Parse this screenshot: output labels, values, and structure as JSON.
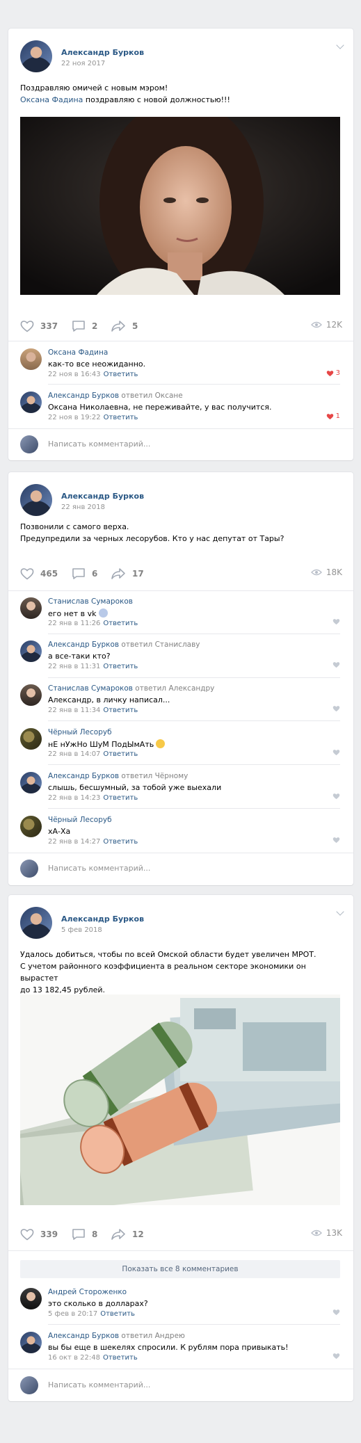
{
  "colors": {
    "link": "#2a5885",
    "muted": "#939393",
    "like": "#e64646",
    "bg": "#edeef0"
  },
  "posts": [
    {
      "author": "Александр Бурков",
      "date": "22 ноя 2017",
      "text_line1": "Поздравляю омичей с новым мэром!",
      "text_link": "Оксана Фадина",
      "text_after_link": " поздравляю с новой должностью!!!",
      "likes": "337",
      "comments": "2",
      "shares": "5",
      "views": "12K",
      "comment_list": [
        {
          "author": "Оксана Фадина",
          "replied": "",
          "text": "как-то все неожиданно.",
          "time": "22 ноя в 16:43",
          "reply": "Ответить",
          "likes": "3"
        },
        {
          "author": "Александр Бурков",
          "replied": " ответил Оксане",
          "text": "Оксана Николаевна, не переживайте, у вас получится.",
          "time": "22 ноя в 19:22",
          "reply": "Ответить",
          "likes": "1"
        }
      ],
      "write_placeholder": "Написать комментарий..."
    },
    {
      "author": "Александр Бурков",
      "date": "22 янв 2018",
      "text_line1": "Позвонили с самого верха.",
      "text_line2": "Предупредили за черных лесорубов. Кто у нас депутат от Тары?",
      "likes": "465",
      "comments": "6",
      "shares": "17",
      "views": "18K",
      "comment_list": [
        {
          "author": "Станислав Сумароков",
          "replied": "",
          "text": "его нет в vk",
          "time": "22 янв в 11:26",
          "reply": "Ответить"
        },
        {
          "author": "Александр Бурков",
          "replied": " ответил Станиславу",
          "text": "а все-таки кто?",
          "time": "22 янв в 11:31",
          "reply": "Ответить"
        },
        {
          "author": "Станислав Сумароков",
          "replied": " ответил Александру",
          "text": "Александр, в личку написал...",
          "time": "22 янв в 11:34",
          "reply": "Ответить"
        },
        {
          "author": "Чёрный Лесоруб",
          "replied": "",
          "text": "нЕ нУжНо ШуМ ПодЫмАть",
          "time": "22 янв в 14:07",
          "reply": "Ответить"
        },
        {
          "author": "Александр Бурков",
          "replied": " ответил Чёрному",
          "text": "слышь, бесшумный, за тобой уже выехали",
          "time": "22 янв в 14:23",
          "reply": "Ответить"
        },
        {
          "author": "Чёрный Лесоруб",
          "replied": "",
          "text": "хА-Ха",
          "time": "22 янв в 14:27",
          "reply": "Ответить"
        }
      ],
      "write_placeholder": "Написать комментарий..."
    },
    {
      "author": "Александр Бурков",
      "date": "5 фев 2018",
      "text_line1": "Удалось добиться, чтобы по всей Омской области будет увеличен МРОТ.",
      "text_line2": "С учетом районного коэффициента в реальном секторе экономики он вырастет",
      "text_line3": "до 13 182,45 рублей.",
      "likes": "339",
      "comments": "8",
      "shares": "12",
      "views": "13K",
      "show_all": "Показать все 8 комментариев",
      "comment_list": [
        {
          "author": "Андрей Стороженко",
          "replied": "",
          "text": "это сколько в долларах?",
          "time": "5 фев в 20:17",
          "reply": "Ответить"
        },
        {
          "author": "Александр Бурков",
          "replied": " ответил Андрею",
          "text": "вы бы еще в шекелях спросили. К рублям пора привыкать!",
          "time": "16 окт в 22:48",
          "reply": "Ответить"
        }
      ],
      "write_placeholder": "Написать комментарий..."
    }
  ]
}
